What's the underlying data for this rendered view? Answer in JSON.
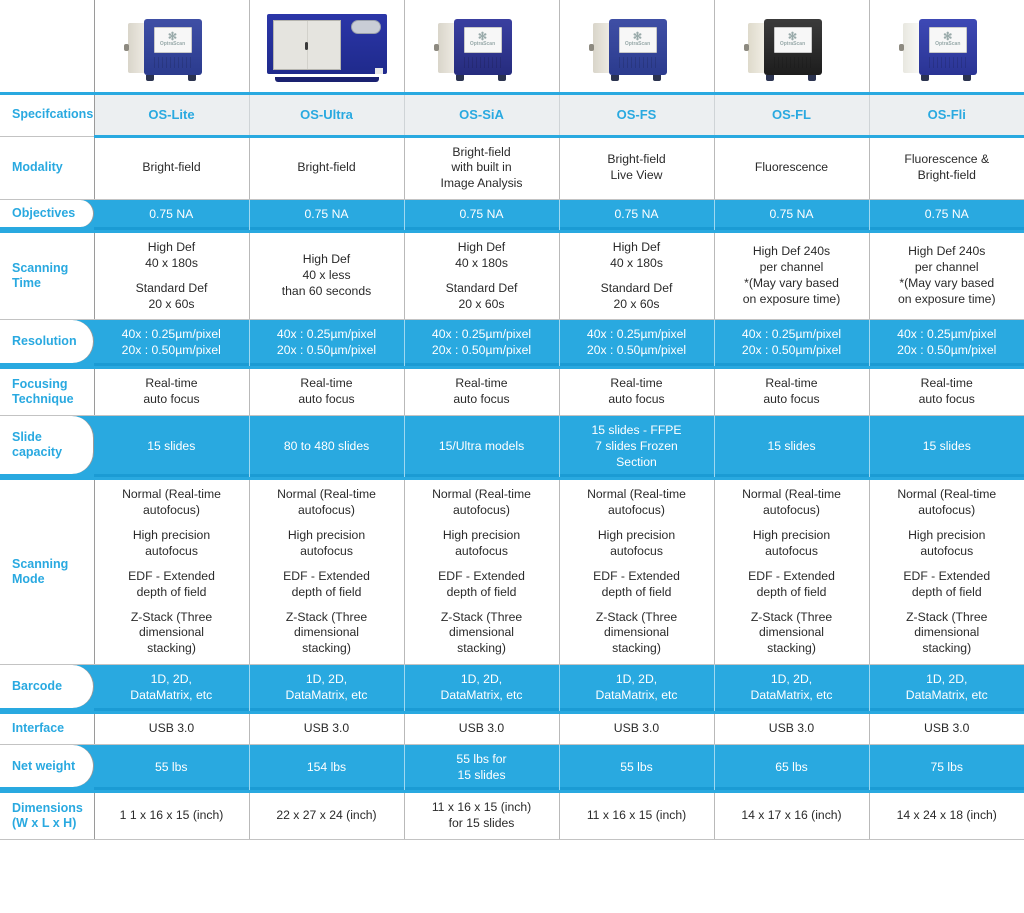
{
  "table": {
    "header_label": "Specifcations",
    "columns": [
      {
        "name": "OS-Lite",
        "device_style": "blue"
      },
      {
        "name": "OS-Ultra",
        "device_style": "cabinet"
      },
      {
        "name": "OS-SiA",
        "device_style": "navy"
      },
      {
        "name": "OS-FS",
        "device_style": "blue"
      },
      {
        "name": "OS-FL",
        "device_style": "black"
      },
      {
        "name": "OS-Fli",
        "device_style": "blue2"
      }
    ],
    "device_logo": "OptraScan",
    "rows": [
      {
        "label": "Modality",
        "highlight": false,
        "values": [
          [
            "Bright-field"
          ],
          [
            "Bright-field"
          ],
          [
            "Bright-field",
            "with built in",
            "Image Analysis"
          ],
          [
            "Bright-field",
            "Live View"
          ],
          [
            "Fluorescence"
          ],
          [
            "Fluorescence &",
            "Bright-field"
          ]
        ]
      },
      {
        "label": "Objectives",
        "highlight": true,
        "values": [
          [
            "0.75 NA"
          ],
          [
            "0.75 NA"
          ],
          [
            "0.75 NA"
          ],
          [
            "0.75 NA"
          ],
          [
            "0.75 NA"
          ],
          [
            "0.75 NA"
          ]
        ]
      },
      {
        "label": "Scanning Time",
        "label_lines": [
          "Scanning",
          "Time"
        ],
        "highlight": false,
        "values": [
          [
            "High Def",
            "40 x 180s",
            "",
            "Standard Def",
            "20 x 60s"
          ],
          [
            "High Def",
            "40 x less",
            "than 60 seconds"
          ],
          [
            "High Def",
            "40 x 180s",
            "",
            "Standard Def",
            "20 x 60s"
          ],
          [
            "High Def",
            "40 x 180s",
            "",
            "Standard Def",
            "20 x 60s"
          ],
          [
            "High Def 240s",
            "per channel",
            "*(May vary based",
            "on exposure time)"
          ],
          [
            "High Def 240s",
            "per channel",
            "*(May vary based",
            "on exposure time)"
          ]
        ]
      },
      {
        "label": "Resolution",
        "highlight": true,
        "values": [
          [
            "40x : 0.25µm/pixel",
            "20x : 0.50µm/pixel"
          ],
          [
            "40x : 0.25µm/pixel",
            "20x : 0.50µm/pixel"
          ],
          [
            "40x : 0.25µm/pixel",
            "20x : 0.50µm/pixel"
          ],
          [
            "40x : 0.25µm/pixel",
            "20x : 0.50µm/pixel"
          ],
          [
            "40x : 0.25µm/pixel",
            "20x : 0.50µm/pixel"
          ],
          [
            "40x : 0.25µm/pixel",
            "20x : 0.50µm/pixel"
          ]
        ]
      },
      {
        "label": "Focusing Technique",
        "label_lines": [
          "Focusing",
          "Technique"
        ],
        "highlight": false,
        "values": [
          [
            "Real-time",
            "auto focus"
          ],
          [
            "Real-time",
            "auto focus"
          ],
          [
            "Real-time",
            "auto focus"
          ],
          [
            "Real-time",
            "auto focus"
          ],
          [
            "Real-time",
            "auto focus"
          ],
          [
            "Real-time",
            "auto focus"
          ]
        ]
      },
      {
        "label": "Slide capacity",
        "label_lines": [
          "Slide",
          "capacity"
        ],
        "highlight": true,
        "values": [
          [
            "15 slides"
          ],
          [
            "80 to 480 slides"
          ],
          [
            "15/Ultra models"
          ],
          [
            "15 slides - FFPE",
            "7 slides Frozen",
            "Section"
          ],
          [
            "15 slides"
          ],
          [
            "15 slides"
          ]
        ]
      },
      {
        "label": "Scanning Mode",
        "label_lines": [
          "Scanning",
          "Mode"
        ],
        "highlight": false,
        "values": [
          [
            "Normal (Real-time",
            "autofocus)",
            "",
            "High precision",
            "autofocus",
            "",
            "EDF - Extended",
            "depth of field",
            "",
            "Z-Stack (Three",
            "dimensional",
            "stacking)"
          ],
          [
            "Normal (Real-time",
            "autofocus)",
            "",
            "High precision",
            "autofocus",
            "",
            "EDF - Extended",
            "depth of field",
            "",
            "Z-Stack (Three",
            "dimensional",
            "stacking)"
          ],
          [
            "Normal (Real-time",
            "autofocus)",
            "",
            "High precision",
            "autofocus",
            "",
            "EDF - Extended",
            "depth of field",
            "",
            "Z-Stack (Three",
            "dimensional",
            "stacking)"
          ],
          [
            "Normal (Real-time",
            "autofocus)",
            "",
            "High precision",
            "autofocus",
            "",
            "EDF - Extended",
            "depth of field",
            "",
            "Z-Stack (Three",
            "dimensional",
            "stacking)"
          ],
          [
            "Normal (Real-time",
            "autofocus)",
            "",
            "High precision",
            "autofocus",
            "",
            "EDF - Extended",
            "depth of field",
            "",
            "Z-Stack (Three",
            "dimensional",
            "stacking)"
          ],
          [
            "Normal (Real-time",
            "autofocus)",
            "",
            "High precision",
            "autofocus",
            "",
            "EDF - Extended",
            "depth of field",
            "",
            "Z-Stack (Three",
            "dimensional",
            "stacking)"
          ]
        ]
      },
      {
        "label": "Barcode",
        "highlight": true,
        "values": [
          [
            "1D, 2D,",
            "DataMatrix, etc"
          ],
          [
            "1D, 2D,",
            "DataMatrix, etc"
          ],
          [
            "1D, 2D,",
            "DataMatrix, etc"
          ],
          [
            "1D, 2D,",
            "DataMatrix, etc"
          ],
          [
            "1D, 2D,",
            "DataMatrix, etc"
          ],
          [
            "1D, 2D,",
            "DataMatrix, etc"
          ]
        ]
      },
      {
        "label": "Interface",
        "highlight": false,
        "values": [
          [
            "USB 3.0"
          ],
          [
            "USB 3.0"
          ],
          [
            "USB 3.0"
          ],
          [
            "USB 3.0"
          ],
          [
            "USB 3.0"
          ],
          [
            "USB 3.0"
          ]
        ]
      },
      {
        "label": "Net weight",
        "highlight": true,
        "values": [
          [
            "55 lbs"
          ],
          [
            "154 lbs"
          ],
          [
            "55 lbs for",
            "15 slides"
          ],
          [
            "55 lbs"
          ],
          [
            "65 lbs"
          ],
          [
            "75 lbs"
          ]
        ]
      },
      {
        "label": "Dimensions (W x L x H)",
        "label_lines": [
          "Dimensions",
          "(W x L x H)"
        ],
        "highlight": false,
        "values": [
          [
            "1 1 x 16 x 15 (inch)"
          ],
          [
            "22 x 27 x 24 (inch)"
          ],
          [
            "11 x 16 x 15 (inch)",
            "for 15 slides"
          ],
          [
            "11 x 16 x 15 (inch)"
          ],
          [
            "14 x 17 x 16 (inch)"
          ],
          [
            "14 x 24 x 18 (inch)"
          ]
        ]
      }
    ]
  },
  "colors": {
    "accent": "#29a9e0",
    "header_bg": "#eceff1",
    "text": "#2a2a2a",
    "border": "#b9b9b9"
  },
  "watermark": {
    "text": "OptraScan"
  }
}
